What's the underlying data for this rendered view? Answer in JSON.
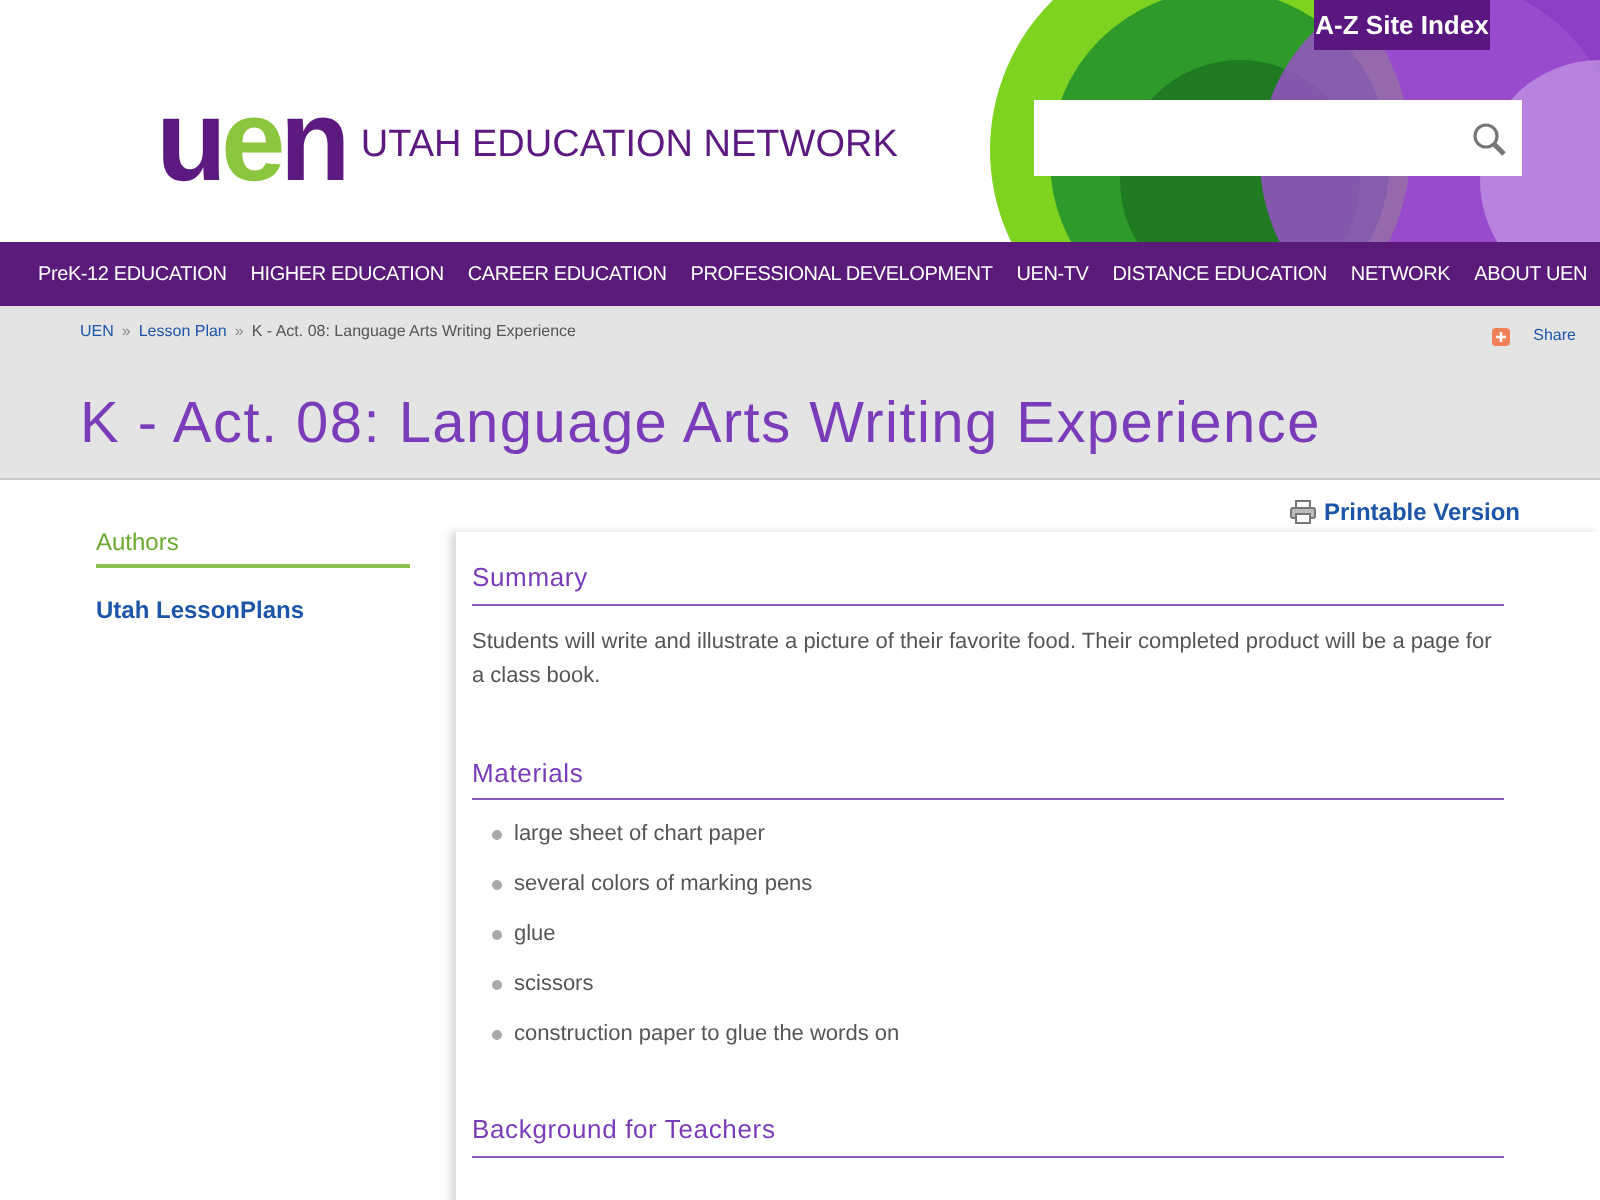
{
  "header": {
    "logo_letters": [
      "u",
      "e",
      "n"
    ],
    "site_name": "UTAH EDUCATION NETWORK",
    "site_index_link": "A-Z Site Index"
  },
  "nav": [
    "PreK-12 EDUCATION",
    "HIGHER EDUCATION",
    "CAREER EDUCATION",
    "PROFESSIONAL DEVELOPMENT",
    "UEN-TV",
    "DISTANCE EDUCATION",
    "NETWORK",
    "ABOUT UEN"
  ],
  "breadcrumb": {
    "links": [
      "UEN",
      "Lesson Plan"
    ],
    "separators": [
      "»",
      "»"
    ],
    "current": "K - Act. 08: Language Arts Writing Experience"
  },
  "share": "Share",
  "page_title": "K - Act. 08: Language Arts Writing Experience",
  "printable": "Printable Version",
  "sidebar": {
    "heading": "Authors",
    "items": [
      "Utah LessonPlans"
    ]
  },
  "sections": [
    {
      "heading": "Summary",
      "kind": "paragraph",
      "text": "Students will write and illustrate a picture of their favorite food. Their completed product will be a page for a class book."
    },
    {
      "heading": "Materials",
      "kind": "list",
      "items": [
        "large sheet of chart paper",
        "several colors of marking pens",
        "glue",
        "scissors",
        "construction paper to glue the words on"
      ]
    },
    {
      "heading": "Background for Teachers",
      "kind": "heading_only"
    }
  ]
}
